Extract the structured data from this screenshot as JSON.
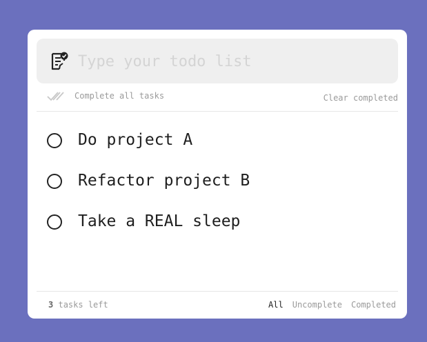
{
  "input": {
    "placeholder": "Type your todo list",
    "value": ""
  },
  "toolbar": {
    "complete_all_label": "Complete all tasks",
    "clear_completed_label": "Clear completed"
  },
  "todos": [
    {
      "text": "Do project A",
      "completed": false
    },
    {
      "text": "Refactor project B",
      "completed": false
    },
    {
      "text": "Take a REAL sleep",
      "completed": false
    }
  ],
  "footer": {
    "count": "3",
    "count_suffix": "tasks left",
    "filters": [
      {
        "label": "All",
        "active": true
      },
      {
        "label": "Uncomplete",
        "active": false
      },
      {
        "label": "Completed",
        "active": false
      }
    ]
  },
  "colors": {
    "background": "#6b70be",
    "card": "#ffffff",
    "input_bar": "#efefef",
    "muted_text": "#9a9a9a"
  },
  "icons": {
    "input": "note-check-icon",
    "complete_all": "double-check-icon",
    "todo": "circle-icon"
  }
}
